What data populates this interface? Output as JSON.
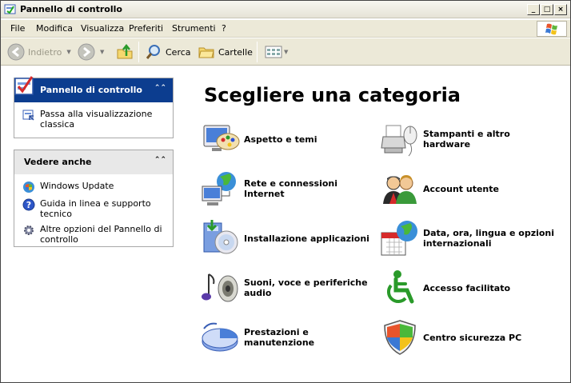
{
  "window": {
    "title": "Pannello di controllo"
  },
  "menu": [
    {
      "label": "File"
    },
    {
      "label": "Modifica"
    },
    {
      "label": "Visualizza"
    },
    {
      "label": "Preferiti"
    },
    {
      "label": "Strumenti"
    },
    {
      "label": "?"
    }
  ],
  "toolbar": {
    "back_label": "Indietro",
    "search_label": "Cerca",
    "folders_label": "Cartelle"
  },
  "left_pane": {
    "control_panel": {
      "title": "Pannello di controllo",
      "tasks": [
        {
          "label": "Passa alla visualizzazione classica"
        }
      ]
    },
    "see_also": {
      "title": "Vedere anche",
      "links": [
        {
          "label": "Windows Update"
        },
        {
          "label": "Guida in linea e supporto tecnico"
        },
        {
          "label": "Altre opzioni del Pannello di controllo"
        }
      ]
    }
  },
  "main": {
    "heading": "Scegliere una categoria",
    "categories": [
      {
        "label": "Aspetto e temi",
        "icon": "appearance-icon"
      },
      {
        "label": "Stampanti e altro hardware",
        "icon": "printer-icon"
      },
      {
        "label": "Rete e connessioni Internet",
        "icon": "network-icon"
      },
      {
        "label": "Account utente",
        "icon": "users-icon"
      },
      {
        "label": "Installazione applicazioni",
        "icon": "install-icon"
      },
      {
        "label": "Data, ora, lingua e opzioni internazionali",
        "icon": "datetime-icon"
      },
      {
        "label": "Suoni, voce e periferiche audio",
        "icon": "sound-icon"
      },
      {
        "label": "Accesso facilitato",
        "icon": "accessibility-icon"
      },
      {
        "label": "Prestazioni e manutenzione",
        "icon": "performance-icon"
      },
      {
        "label": "Centro sicurezza PC",
        "icon": "shield-icon"
      }
    ]
  }
}
